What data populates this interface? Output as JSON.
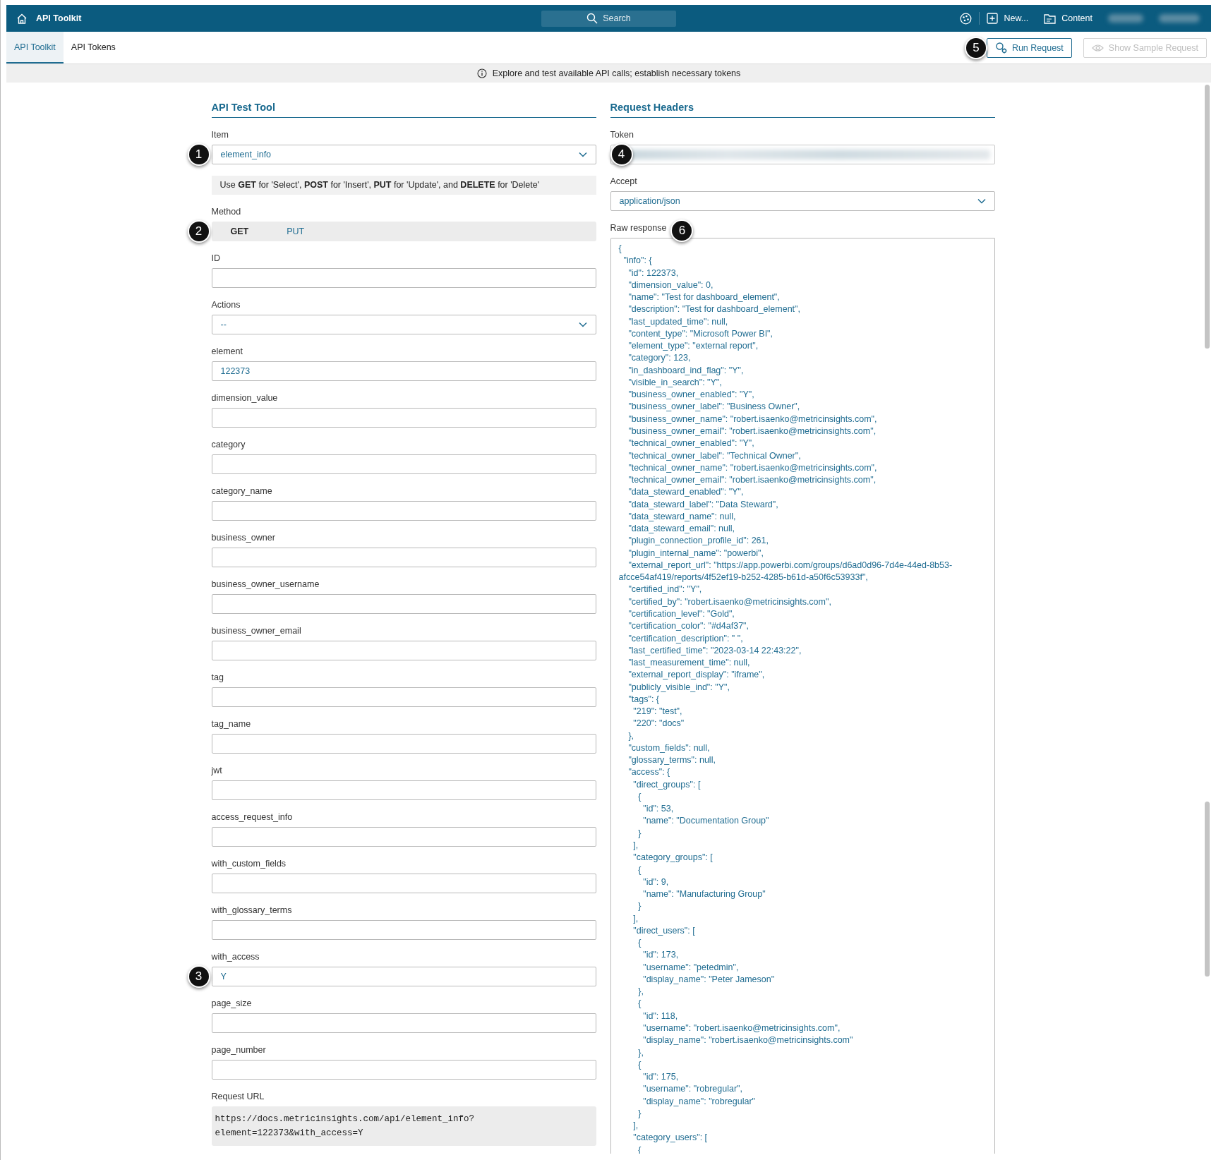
{
  "top_bar": {
    "title": "API Toolkit",
    "search_placeholder": "Search",
    "user_menu_redacted": true,
    "actions": [
      {
        "kind": "palette"
      },
      {
        "kind": "new",
        "label": "New..."
      },
      {
        "kind": "content",
        "label": "Content"
      }
    ]
  },
  "tabs": [
    {
      "label": "API Toolkit",
      "selected": true
    },
    {
      "label": "API Tokens",
      "selected": false
    }
  ],
  "toolbar_buttons": [
    {
      "kind": "run",
      "label": "Run Request",
      "disabled": false,
      "callout": "5"
    },
    {
      "kind": "sample",
      "label": "Show Sample Request",
      "disabled": true
    }
  ],
  "info_bar": {
    "text": "Explore and test available API calls; establish necessary tokens"
  },
  "left_panel": {
    "title": "API Test Tool",
    "fields": [
      {
        "kind": "select",
        "label": "Item",
        "value": "element_info",
        "callout": "1"
      },
      {
        "kind": "hint",
        "text": "Use **GET** for 'Select', **POST** for 'Insert', **PUT** for 'Update', and **DELETE** for 'Delete'"
      },
      {
        "kind": "segmented",
        "label": "Method",
        "callout": "2",
        "options": [
          {
            "label": "GET",
            "selected": true
          },
          {
            "label": "PUT",
            "selected": false
          }
        ]
      },
      {
        "kind": "input",
        "label": "ID"
      },
      {
        "kind": "select",
        "label": "Actions",
        "value": "--"
      },
      {
        "kind": "input",
        "label": "element",
        "value": "122373"
      },
      {
        "kind": "input",
        "label": "dimension_value"
      },
      {
        "kind": "input",
        "label": "category"
      },
      {
        "kind": "input",
        "label": "category_name"
      },
      {
        "kind": "input",
        "label": "business_owner"
      },
      {
        "kind": "input",
        "label": "business_owner_username"
      },
      {
        "kind": "input",
        "label": "business_owner_email"
      },
      {
        "kind": "input",
        "label": "tag"
      },
      {
        "kind": "input",
        "label": "tag_name"
      },
      {
        "kind": "input",
        "label": "jwt"
      },
      {
        "kind": "input",
        "label": "access_request_info"
      },
      {
        "kind": "input",
        "label": "with_custom_fields"
      },
      {
        "kind": "input",
        "label": "with_glossary_terms"
      },
      {
        "kind": "input",
        "label": "with_access",
        "value": "Y",
        "callout": "3"
      },
      {
        "kind": "input",
        "label": "page_size"
      },
      {
        "kind": "input",
        "label": "page_number"
      },
      {
        "kind": "code",
        "label": "Request URL",
        "lines": [
          "https://docs.metricinsights.com/api/element_info?",
          "element=122373&with_access=Y"
        ]
      }
    ]
  },
  "right_panel": {
    "title": "Request Headers",
    "fields": [
      {
        "kind": "input",
        "label": "Token",
        "redacted": true,
        "callout": "4"
      },
      {
        "kind": "select",
        "label": "Accept",
        "value": "application/json"
      },
      {
        "kind": "response",
        "label": "Raw response",
        "callout": "6",
        "lines": [
          "{",
          "  \"info\": {",
          "    \"id\": 122373,",
          "    \"dimension_value\": 0,",
          "    \"name\": \"Test for dashboard_element\",",
          "    \"description\": \"Test for dashboard_element\",",
          "    \"last_updated_time\": null,",
          "    \"content_type\": \"Microsoft Power BI\",",
          "    \"element_type\": \"external report\",",
          "    \"category\": 123,",
          "    \"in_dashboard_ind_flag\": \"Y\",",
          "    \"visible_in_search\": \"Y\",",
          "    \"business_owner_enabled\": \"Y\",",
          "    \"business_owner_label\": \"Business Owner\",",
          "    \"business_owner_name\": \"robert.isaenko@metricinsights.com\",",
          "    \"business_owner_email\": \"robert.isaenko@metricinsights.com\",",
          "    \"technical_owner_enabled\": \"Y\",",
          "    \"technical_owner_label\": \"Technical Owner\",",
          "    \"technical_owner_name\": \"robert.isaenko@metricinsights.com\",",
          "    \"technical_owner_email\": \"robert.isaenko@metricinsights.com\",",
          "    \"data_steward_enabled\": \"Y\",",
          "    \"data_steward_label\": \"Data Steward\",",
          "    \"data_steward_name\": null,",
          "    \"data_steward_email\": null,",
          "    \"plugin_connection_profile_id\": 261,",
          "    \"plugin_internal_name\": \"powerbi\",",
          "    \"external_report_url\": \"https://app.powerbi.com/groups/d6ad0d96-7d4e-44ed-8b53-",
          "afcce54af419/reports/4f52ef19-b252-4285-b61d-a50f6c53933f\",",
          "    \"certified_ind\": \"Y\",",
          "    \"certified_by\": \"robert.isaenko@metricinsights.com\",",
          "    \"certification_level\": \"Gold\",",
          "    \"certification_color\": \"#d4af37\",",
          "    \"certification_description\": \" \",",
          "    \"last_certified_time\": \"2023-03-14 22:43:22\",",
          "    \"last_measurement_time\": null,",
          "    \"external_report_display\": \"iframe\",",
          "    \"publicly_visible_ind\": \"Y\",",
          "    \"tags\": {",
          "      \"219\": \"test\",",
          "      \"220\": \"docs\"",
          "    },",
          "    \"custom_fields\": null,",
          "    \"glossary_terms\": null,",
          "    \"access\": {",
          "      \"direct_groups\": [",
          "        {",
          "          \"id\": 53,",
          "          \"name\": \"Documentation Group\"",
          "        }",
          "      ],",
          "      \"category_groups\": [",
          "        {",
          "          \"id\": 9,",
          "          \"name\": \"Manufacturing Group\"",
          "        }",
          "      ],",
          "      \"direct_users\": [",
          "        {",
          "          \"id\": 173,",
          "          \"username\": \"petedmin\",",
          "          \"display_name\": \"Peter Jameson\"",
          "        },",
          "        {",
          "          \"id\": 118,",
          "          \"username\": \"robert.isaenko@metricinsights.com\",",
          "          \"display_name\": \"robert.isaenko@metricinsights.com\"",
          "        },",
          "        {",
          "          \"id\": 175,",
          "          \"username\": \"robregular\",",
          "          \"display_name\": \"robregular\"",
          "        }",
          "      ],",
          "      \"category_users\": [",
          "        {"
        ]
      }
    ]
  }
}
